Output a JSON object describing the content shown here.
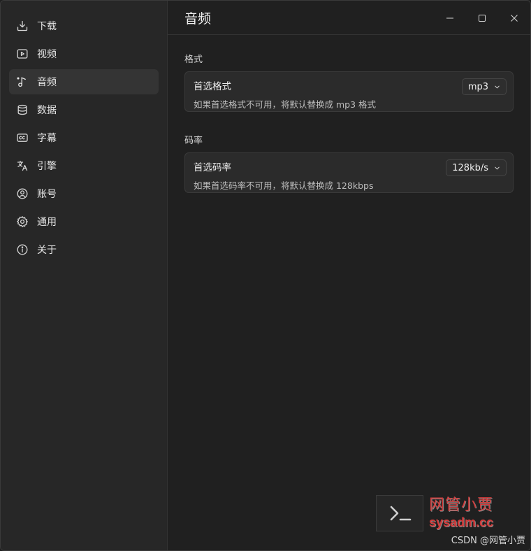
{
  "sidebar": {
    "items": [
      {
        "label": "下载",
        "icon": "download-icon"
      },
      {
        "label": "视频",
        "icon": "video-icon"
      },
      {
        "label": "音频",
        "icon": "audio-icon",
        "active": true
      },
      {
        "label": "数据",
        "icon": "database-icon"
      },
      {
        "label": "字幕",
        "icon": "subtitle-icon"
      },
      {
        "label": "引擎",
        "icon": "translate-icon"
      },
      {
        "label": "账号",
        "icon": "account-icon"
      },
      {
        "label": "通用",
        "icon": "gear-icon"
      },
      {
        "label": "关于",
        "icon": "info-icon"
      }
    ]
  },
  "header": {
    "title": "音频"
  },
  "sections": [
    {
      "label": "格式",
      "card": {
        "title": "首选格式",
        "description": "如果首选格式不可用，将默认替换成 mp3 格式",
        "value": "mp3"
      }
    },
    {
      "label": "码率",
      "card": {
        "title": "首选码率",
        "description": "如果首选码率不可用，将默认替换成 128kbps",
        "value": "128kb/s"
      }
    }
  ],
  "watermark": {
    "cn": "网管小贾",
    "en": "sysadm.cc"
  },
  "footer": {
    "credit": "CSDN @网管小贾"
  },
  "colors": {
    "background": "#202020",
    "sidebar": "#272727",
    "card": "#2b2b2b",
    "active": "#343434",
    "watermark": "#d13a3a"
  }
}
